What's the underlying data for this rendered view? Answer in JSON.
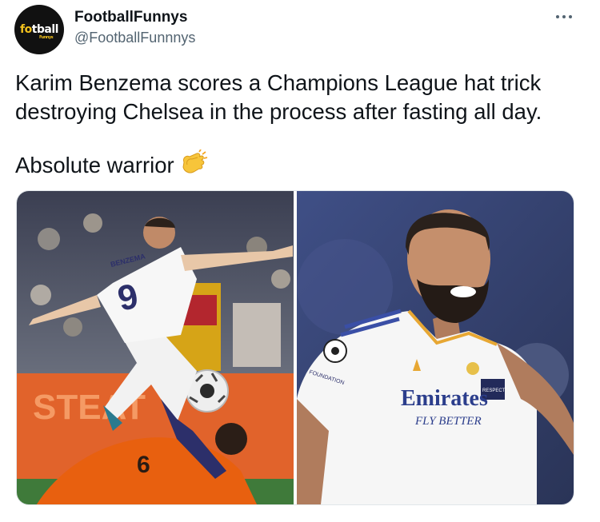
{
  "account": {
    "display_name": "FootballFunnys",
    "handle": "@FootballFunnnys",
    "avatar_logo": "fo",
    "avatar_logo_accent": "tball",
    "avatar_logo_sub": "Funnys"
  },
  "menu_icon": "more-horizontal-icon",
  "tweet": {
    "text_line1": "Karim Benzema scores a Champions League hat trick",
    "text_line2": "destroying Chelsea in the process after fasting all day.",
    "text_line3": "Absolute warrior",
    "emoji": "clapping-hands-emoji"
  },
  "images": {
    "left": {
      "jersey_name": "BENZEMA",
      "jersey_number": "9",
      "opponent_number": "6"
    },
    "right": {
      "sponsor": "Emirates",
      "sponsor_tagline": "FLY BETTER",
      "sleeve_patch": "FOUNDATION",
      "captain_band": "RESPECT"
    }
  },
  "colors": {
    "name": "#0f1419",
    "secondary": "#536471",
    "avatar_bg": "#111111",
    "avatar_logo": "#f3c21d"
  }
}
